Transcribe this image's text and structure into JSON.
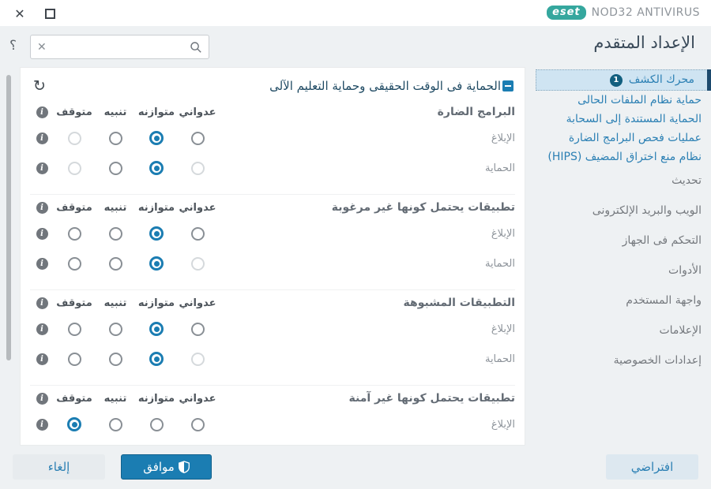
{
  "titlebar": {
    "close_icon": "✕",
    "product": "NOD32 ANTIVIRUS",
    "logo_text": "eset"
  },
  "search": {
    "value": "",
    "placeholder": "",
    "clear_icon": "✕"
  },
  "page_title": "الإعداد المتقدم",
  "help_icon": "؟",
  "sidebar": {
    "selected": {
      "label": "محرك الكشف",
      "badge": "1"
    },
    "blue_items": [
      {
        "label": "حماية نظام الملفات الحالى"
      },
      {
        "label": "الحماية المستندة إلى السحابة"
      },
      {
        "label": "عمليات فحص البرامج الضارة"
      },
      {
        "label": "نظام منع اختراق المضيف (HIPS)"
      }
    ],
    "gray_items": [
      {
        "label": "تحديث"
      },
      {
        "label": "الويب والبريد الإلكترونى"
      },
      {
        "label": "التحكم فى الجهاز"
      },
      {
        "label": "الأدوات"
      },
      {
        "label": "واجهة المستخدم"
      },
      {
        "label": "الإعلامات"
      },
      {
        "label": "إعدادات الخصوصية"
      }
    ]
  },
  "panel": {
    "title": "الحماية فى الوقت الحقيقى وحماية التعليم الآلى",
    "refresh_icon": "↻",
    "column_headers": {
      "aggressive": "عدواني",
      "balanced": "متوازنه",
      "cautious": "تنبيه",
      "off": "متوقف"
    },
    "sections": [
      {
        "title": "البرامج الضارة",
        "rows": [
          {
            "label": "الإبلاغ",
            "states": {
              "aggressive": "normal",
              "balanced": "selected",
              "cautious": "normal",
              "off": "disabled"
            }
          },
          {
            "label": "الحماية",
            "states": {
              "aggressive": "disabled",
              "balanced": "selected",
              "cautious": "normal",
              "off": "disabled"
            }
          }
        ]
      },
      {
        "title": "تطبيقات يحتمل كونها غير مرغوبة",
        "rows": [
          {
            "label": "الإبلاغ",
            "states": {
              "aggressive": "normal",
              "balanced": "selected",
              "cautious": "normal",
              "off": "normal"
            }
          },
          {
            "label": "الحماية",
            "states": {
              "aggressive": "disabled",
              "balanced": "selected",
              "cautious": "normal",
              "off": "normal"
            }
          }
        ]
      },
      {
        "title": "التطبيقات المشبوهة",
        "rows": [
          {
            "label": "الإبلاغ",
            "states": {
              "aggressive": "normal",
              "balanced": "selected",
              "cautious": "normal",
              "off": "normal"
            }
          },
          {
            "label": "الحماية",
            "states": {
              "aggressive": "disabled",
              "balanced": "selected",
              "cautious": "normal",
              "off": "normal"
            }
          }
        ]
      },
      {
        "title": "تطبيقات يحتمل كونها غير آمنة",
        "rows": [
          {
            "label": "الإبلاغ",
            "states": {
              "aggressive": "normal",
              "balanced": "normal",
              "cautious": "normal",
              "off": "selected"
            }
          }
        ]
      }
    ]
  },
  "footer": {
    "ok": "موافق",
    "cancel": "إلغاء",
    "default": "افتراضي"
  },
  "colors": {
    "accent": "#1b7db2",
    "logo_teal": "#35a79e",
    "selected_item_bg": "#cfe4f2",
    "selected_indicator": "#1c4a6e",
    "badge_bg": "#125f7f",
    "background": "#eef1f3"
  }
}
